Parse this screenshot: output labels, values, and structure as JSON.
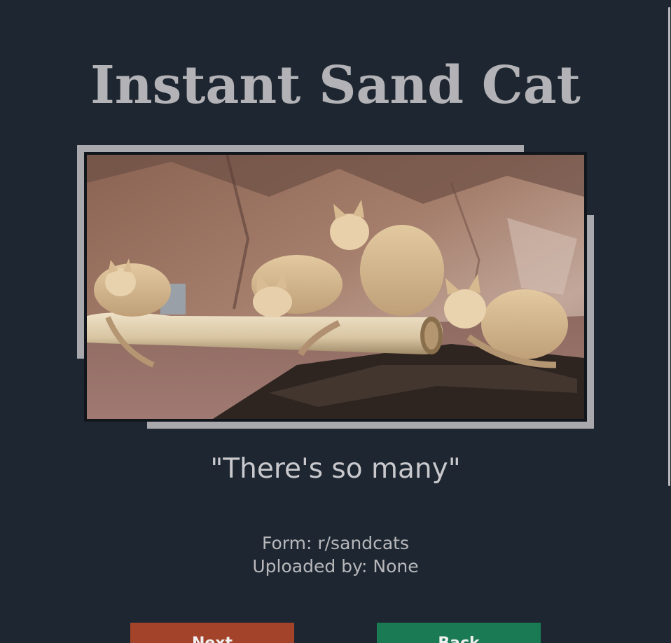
{
  "page": {
    "title": "Instant Sand Cat",
    "caption": "\"There's so many\"",
    "form": "Form: r/sandcats",
    "uploaded_by": "Uploaded by: None"
  },
  "image": {
    "alt": "Sand cats sitting on a log"
  },
  "buttons": {
    "next_label": "Next",
    "back_label": "Back"
  },
  "colors": {
    "background": "#1e2731",
    "title": "#b3b3b7",
    "frame": "#a9a9ad",
    "next_button": "#a3432a",
    "back_button": "#1a7a53"
  }
}
